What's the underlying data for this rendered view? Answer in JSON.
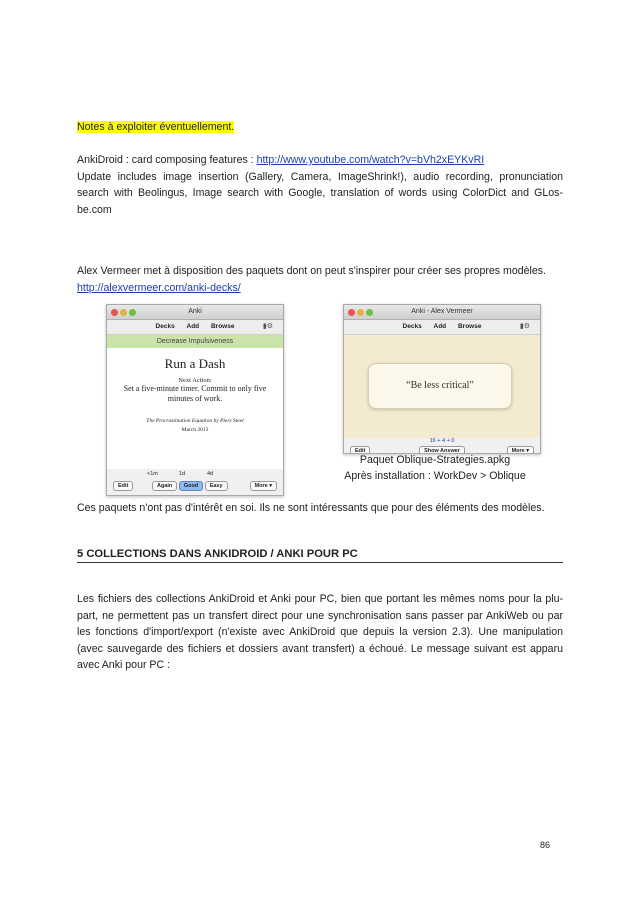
{
  "notes": {
    "heading": "Notes à exploiter éventuellement.",
    "ankidroid_label": "AnkiDroid : card composing features : ",
    "ankidroid_url": "http://www.youtube.com/watch?v=bVh2xEYKvRI",
    "ankidroid_text": "Update includes image insertion (Gallery, Camera, ImageShrink!), audio recording, pronunciation search with Beolingus, Image search with Google, translation of words using ColorDict and GLos-be.com"
  },
  "vermeer": {
    "text": "Alex Vermeer met à disposition des paquets dont on peut s'inspirer pour créer ses propres modèles.",
    "url": "http://alexvermeer.com/anki-decks/"
  },
  "screenshot1": {
    "window_title": "Anki",
    "toolbar": [
      "Decks",
      "Add",
      "Browse"
    ],
    "banner": "Decrease Impulsiveness",
    "card_title": "Run a Dash",
    "next_action_label": "Next Action:",
    "next_action_text": "Set a five-minute timer. Commit to only five minutes of work.",
    "source": "The Procrastination Equation by Piers Steel",
    "date": "March 2013",
    "intervals": [
      "<1m",
      "1d",
      "4d"
    ],
    "buttons": [
      "Edit",
      "Again",
      "Good",
      "Easy",
      "More ▾"
    ]
  },
  "screenshot2": {
    "window_title": "Anki - Alex Vermeer",
    "toolbar": [
      "Decks",
      "Add",
      "Browse"
    ],
    "card_text": "“Be less critical”",
    "counts": "16 + 4 + 0",
    "buttons": [
      "Edit",
      "Show Answer",
      "More ▾"
    ]
  },
  "caption": {
    "line1": "Paquet Oblique-Strategies.apkg",
    "line2": "Après installation : WorkDev > Oblique"
  },
  "after_screens": "Ces paquets n'ont pas d'intérêt en soi. Ils ne sont intéressants que pour des éléments des modèles.",
  "section": {
    "title": "5 COLLECTIONS DANS ANKIDROID / ANKI POUR PC",
    "paragraph": "Les fichiers des collections AnkiDroid et Anki pour PC, bien que portant les mêmes noms pour la plu-part, ne permettent pas un transfert direct pour une synchronisation sans passer par AnkiWeb ou par les fonctions d'import/export (n'existe avec AnkiDroid que depuis la version 2.3). Une manipulation (avec sauvegarde des fichiers et dossiers avant transfert) a échoué. Le message suivant est apparu avec Anki pour PC :"
  },
  "page_number": "86"
}
